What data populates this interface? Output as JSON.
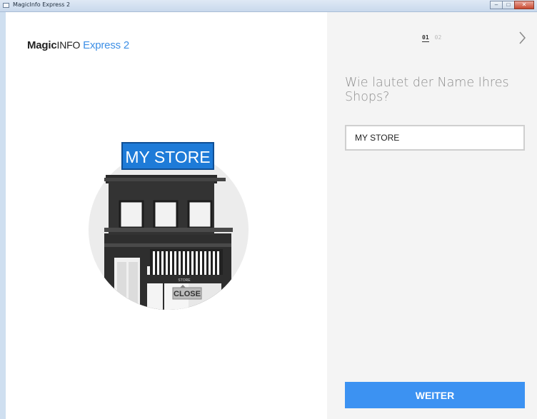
{
  "window": {
    "title": "MagicInfo Express 2",
    "buttons": [
      "minimize",
      "maximize",
      "close"
    ]
  },
  "logo": {
    "magic": "Magic",
    "info": "INFO",
    "express": " Express 2"
  },
  "illustration": {
    "sign_text": "MY STORE",
    "awning_text": "STORE",
    "door_sign": "CLOSE"
  },
  "steps": {
    "current": "01",
    "next": "02"
  },
  "question": "Wie lautet der Name Ihres Shops?",
  "store_name_input": {
    "value": "MY STORE"
  },
  "next_button": "WEITER",
  "colors": {
    "accent": "#3c92f2",
    "panel": "#f4f4f4",
    "sign": "#1e7bd8"
  }
}
